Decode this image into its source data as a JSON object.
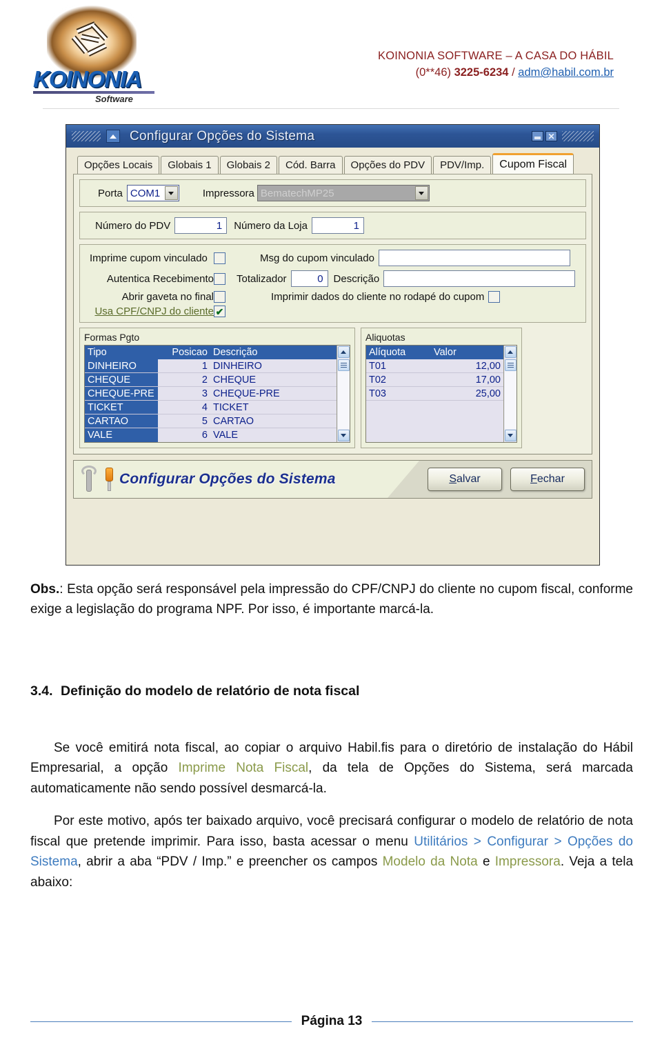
{
  "header": {
    "logo_word": "KOINONIA",
    "logo_sub": "Software",
    "company_name": "KOINONIA SOFTWARE – A CASA DO HÁBIL",
    "company_phone_prefix": "(0**46) ",
    "company_phone": "3225-6234",
    "company_sep": " / ",
    "company_email": "adm@habil.com.br"
  },
  "dialog": {
    "title": "Configurar Opções do Sistema",
    "minimize_label": "",
    "close_label": "",
    "tabs": [
      {
        "label": "Opções Locais",
        "active": false
      },
      {
        "label": "Globais 1",
        "active": false
      },
      {
        "label": "Globais 2",
        "active": false
      },
      {
        "label": "Cód. Barra",
        "active": false
      },
      {
        "label": "Opções do PDV",
        "active": false
      },
      {
        "label": "PDV/Imp.",
        "active": false
      },
      {
        "label": "Cupom Fiscal",
        "active": true
      }
    ],
    "group_port": {
      "porta_label": "Porta",
      "porta_value": "COM1",
      "impressora_label": "Impressora",
      "impressora_value": "BematechMP25"
    },
    "group_numbers": {
      "pdv_label": "Número do PDV",
      "pdv_value": "1",
      "loja_label": "Número da Loja",
      "loja_value": "1"
    },
    "group_options": {
      "imprime_cupom_label": "Imprime cupom vinculado",
      "imprime_cupom_checked": "",
      "msg_cupom_label": "Msg do cupom vinculado",
      "msg_cupom_value": "",
      "autentica_label": "Autentica Recebimento",
      "autentica_checked": "",
      "totalizador_label": "Totalizador",
      "totalizador_value": "0",
      "descricao_label": "Descrição",
      "descricao_value": "",
      "abrir_gaveta_label": "Abrir gaveta no final",
      "abrir_gaveta_checked": "",
      "imprimir_dados_label": "Imprimir dados do cliente no rodapé do cupom",
      "imprimir_dados_checked": "",
      "usa_cpf_label": "Usa CPF/CNPJ do cliente",
      "usa_cpf_checked": "✔"
    },
    "formas_pgto": {
      "caption": "Formas Pgto",
      "columns": [
        "Tipo",
        "Posicao",
        "Descrição"
      ],
      "rows": [
        {
          "tipo": "DINHEIRO",
          "posicao": "1",
          "descricao": "DINHEIRO"
        },
        {
          "tipo": "CHEQUE",
          "posicao": "2",
          "descricao": "CHEQUE"
        },
        {
          "tipo": "CHEQUE-PRE",
          "posicao": "3",
          "descricao": "CHEQUE-PRE"
        },
        {
          "tipo": "TICKET",
          "posicao": "4",
          "descricao": "TICKET"
        },
        {
          "tipo": "CARTAO",
          "posicao": "5",
          "descricao": "CARTAO"
        },
        {
          "tipo": "VALE",
          "posicao": "6",
          "descricao": "VALE"
        }
      ]
    },
    "aliquotas": {
      "caption": "Aliquotas",
      "columns": [
        "Alíquota",
        "Valor"
      ],
      "rows": [
        {
          "aliquota": "T01",
          "valor": "12,00"
        },
        {
          "aliquota": "T02",
          "valor": "17,00"
        },
        {
          "aliquota": "T03",
          "valor": "25,00"
        }
      ]
    },
    "footer": {
      "title": "Configurar Opções do Sistema",
      "save_label": "Salvar",
      "save_accel": "S",
      "save_rest": "alvar",
      "close_label": "Fechar",
      "close_accel": "F",
      "close_rest": "echar"
    }
  },
  "content": {
    "obs_bold": "Obs.",
    "obs_text": ": Esta opção será responsável pela impressão do CPF/CNPJ do cliente no cupom fiscal, conforme exige a legislação do programa NPF. Por isso, é importante marcá-la.",
    "section_number": "3.4.",
    "section_title": "Definição do modelo de relatório de nota fiscal",
    "p1_a": "Se você emitirá nota fiscal, ao copiar o arquivo Habil.fis para o diretório de instalação do Hábil Empresarial, a opção ",
    "p1_olive": "Imprime Nota Fiscal",
    "p1_b": ", da tela de Opções do Sistema, será marcada automaticamente não sendo possível desmarcá-la.",
    "p2_a": "Por este motivo, após ter baixado arquivo, você precisará configurar o modelo de relatório de nota fiscal que pretende imprimir. Para isso, basta acessar o menu ",
    "p2_blue": "Utilitários > Configurar > Opções do Sistema",
    "p2_b": ", abrir a aba “PDV / Imp.” e preencher os campos ",
    "p2_olive1": "Modelo da Nota",
    "p2_c": " e ",
    "p2_olive2": "Impressora",
    "p2_d": ". Veja a tela abaixo:"
  },
  "footer": {
    "page_label": "Página 13"
  },
  "colors": {
    "titlebar_blue": "#2f5496",
    "tab_accent": "#f0a12e",
    "grid_header_blue": "#2f5fa8",
    "company_red": "#8a1f1f",
    "link_blue": "#1f5fb0",
    "olive": "#8a9a4a",
    "menu_blue": "#3d7bbf",
    "footer_rule": "#4a7ebb"
  }
}
